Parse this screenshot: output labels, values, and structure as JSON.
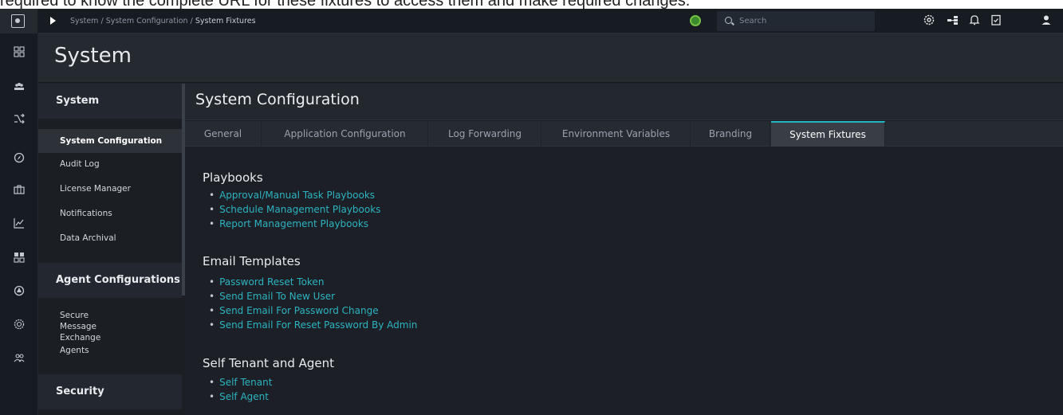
{
  "caption_fragment": "required to know the complete URL for these fixtures to access them and make required changes.",
  "topbar": {
    "breadcrumb": [
      "System",
      "System Configuration",
      "System Fixtures"
    ],
    "breadcrumb_separator": "/",
    "search_placeholder": "Search",
    "icons": [
      "logo-icon",
      "play-icon",
      "status-indicator-icon",
      "search-icon",
      "settings-gear-icon",
      "hierarchy-icon",
      "notification-bell-icon",
      "task-checklist-icon",
      "user-icon"
    ]
  },
  "leftnav": {
    "icons": [
      "dashboard-icon",
      "teams-icon",
      "shuffle-icon",
      "compass-icon",
      "briefcase-icon",
      "chart-icon",
      "apps-grid-icon",
      "radar-icon",
      "globe-settings-icon",
      "users-icon"
    ]
  },
  "page": {
    "title": "System"
  },
  "sidebar": {
    "sections": [
      {
        "label": "System",
        "items": [
          "System Configuration",
          "Audit Log",
          "License Manager",
          "Notifications",
          "Data Archival"
        ]
      },
      {
        "label": "Agent Configurations",
        "items": [
          "Secure Message Exchange",
          "Agents"
        ]
      },
      {
        "label": "Security Management",
        "items": []
      }
    ],
    "active_item": "System Configuration"
  },
  "content": {
    "title": "System Configuration",
    "tabs": [
      "General",
      "Application Configuration",
      "Log Forwarding",
      "Environment Variables",
      "Branding",
      "System Fixtures"
    ],
    "active_tab": "System Fixtures",
    "groups": [
      {
        "title": "Playbooks",
        "links": [
          "Approval/Manual Task Playbooks",
          "Schedule Management Playbooks",
          "Report Management Playbooks"
        ]
      },
      {
        "title": "Email Templates",
        "links": [
          "Password Reset Token",
          "Send Email To New User",
          "Send Email For Password Change",
          "Send Email For Reset Password By Admin"
        ]
      },
      {
        "title": "Self Tenant and Agent",
        "links": [
          "Self Tenant",
          "Self Agent"
        ]
      }
    ]
  },
  "colors": {
    "link": "#2cb3c1",
    "tab_accent": "#27b7c4",
    "status_green": "#76c043"
  }
}
